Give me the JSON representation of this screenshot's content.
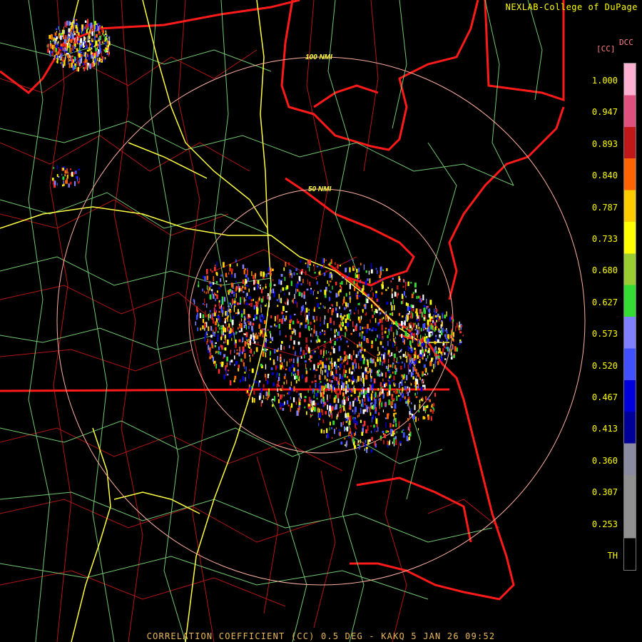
{
  "credit": "NEXLAB-College of DuPage",
  "footer": "CORRELATION COEFFICIENT (CC) 0.5 DEG - KAKQ 5 JAN 26 09:52",
  "legend": {
    "product_code": "DCC",
    "unit": "[CC]",
    "labels": [
      "1.000",
      "0.947",
      "0.893",
      "0.840",
      "0.787",
      "0.733",
      "0.680",
      "0.627",
      "0.573",
      "0.520",
      "0.467",
      "0.413",
      "0.360",
      "0.307",
      "0.253",
      "TH"
    ],
    "colors": [
      "#ffb0d0",
      "#e0507f",
      "#c01818",
      "#ff6400",
      "#ffcc00",
      "#ffff00",
      "#9acd32",
      "#33dd33",
      "#8080ff",
      "#4050ff",
      "#0000dd",
      "#000099",
      "#8a8aa0",
      "#909090",
      "#909090",
      "#000000"
    ]
  },
  "range_rings": [
    "100 NMI",
    "50 NMI"
  ],
  "radar_site": "KAKQ",
  "colors": {
    "boundary_state": "#ff1a1a",
    "boundary_county": "#c01515",
    "roads": "#7fdf7f",
    "highways": "#ffff40",
    "ring": "#ffb0a0",
    "ring_label": "#ffff40"
  }
}
